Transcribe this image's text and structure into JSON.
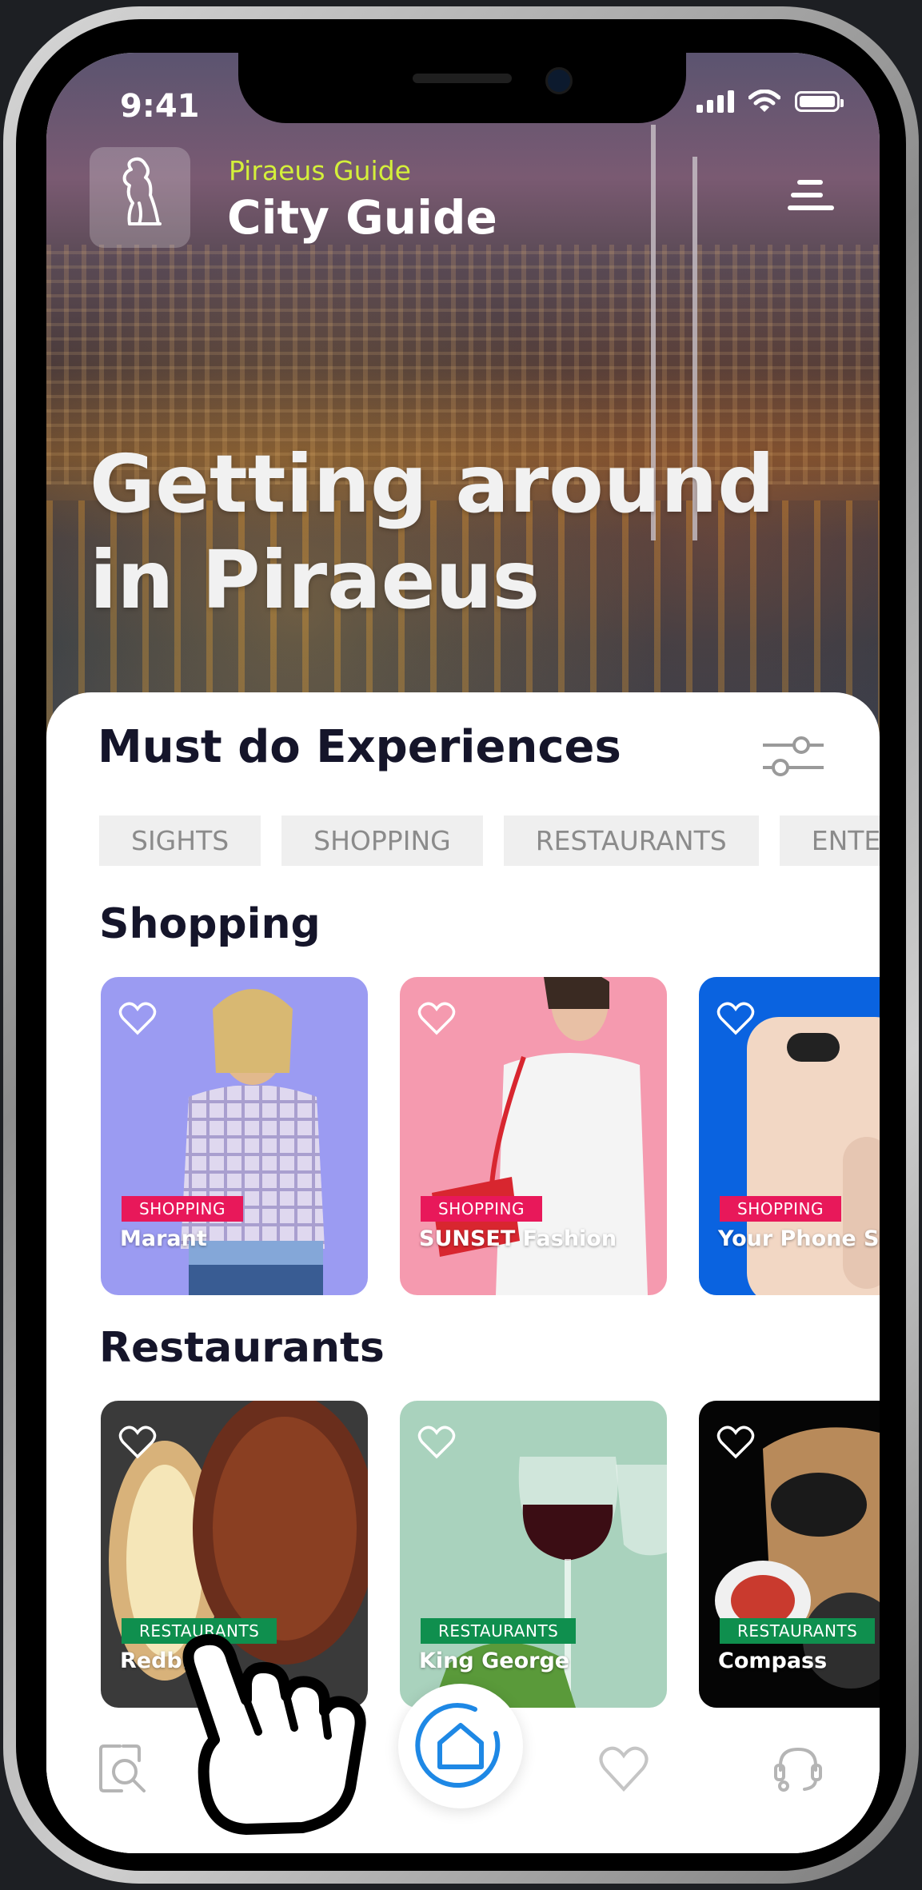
{
  "status": {
    "time": "9:41"
  },
  "header": {
    "subtitle": "Piraeus Guide",
    "title": "City Guide"
  },
  "hero": {
    "title_line1": "Getting around",
    "title_line2": "in Piraeus"
  },
  "experiences": {
    "title": "Must do Experiences",
    "chips": [
      "SIGHTS",
      "SHOPPING",
      "RESTAURANTS",
      "ENTERTA"
    ]
  },
  "shopping": {
    "title": "Shopping",
    "items": [
      {
        "tag": "SHOPPING",
        "name": "Marant",
        "bg": "#9b9bf2"
      },
      {
        "tag": "SHOPPING",
        "name": "SUNSET Fashion",
        "bg": "#f59aaf"
      },
      {
        "tag": "SHOPPING",
        "name": "Your Phone Sho",
        "bg": "#0a63e0"
      }
    ]
  },
  "restaurants": {
    "title": "Restaurants",
    "items": [
      {
        "tag": "RESTAURANTS",
        "name": "Redbird",
        "bg": "#3a3a3a"
      },
      {
        "tag": "RESTAURANTS",
        "name": "King George",
        "bg": "#a9d2bd"
      },
      {
        "tag": "RESTAURANTS",
        "name": "Compass",
        "bg": "#050505"
      }
    ]
  },
  "colors": {
    "accent": "#1e88e5",
    "subtitle": "#d4f03a",
    "shop_tag": "#e8185a",
    "rest_tag": "#0f8f4e"
  },
  "tabbar": {
    "icons": [
      "search-icon",
      "home-icon",
      "heart-icon",
      "support-icon"
    ]
  }
}
